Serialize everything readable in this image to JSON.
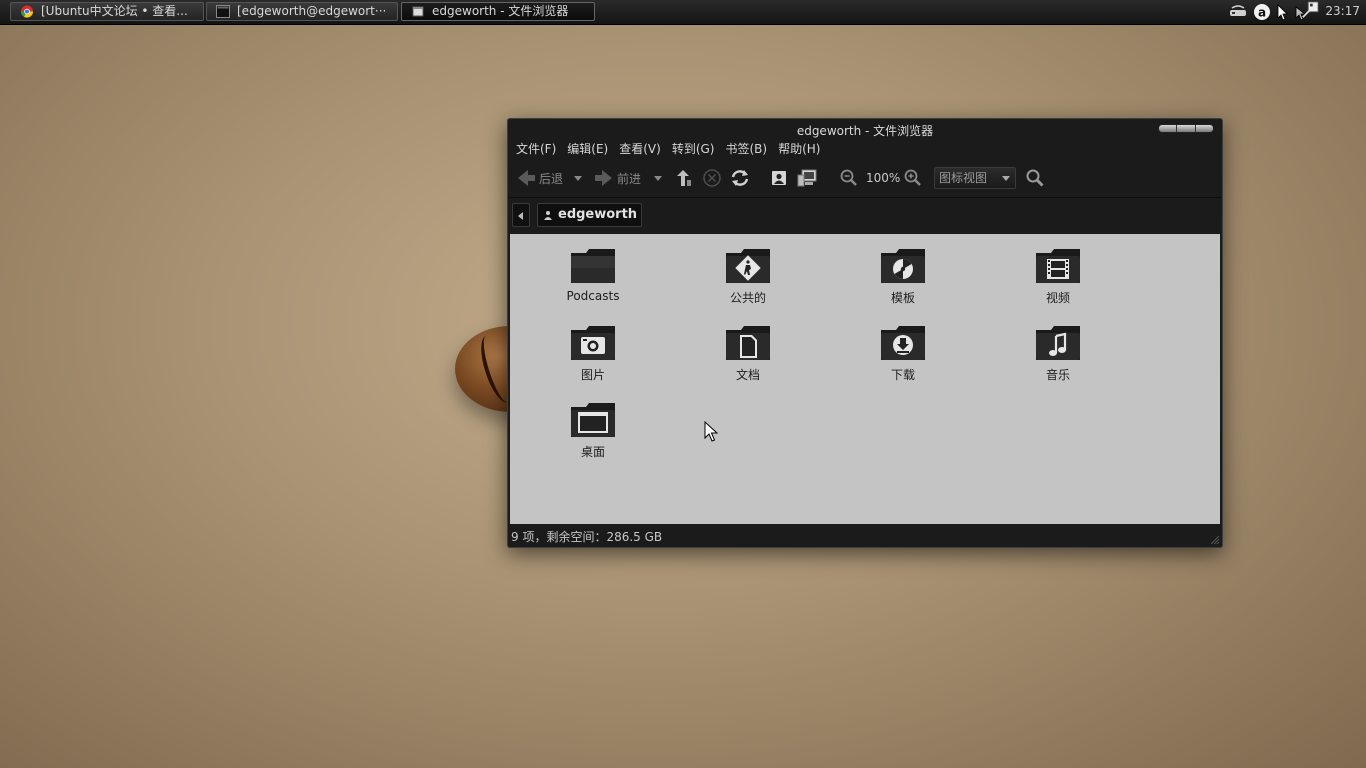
{
  "taskbar": {
    "tasks": [
      {
        "label": "[Ubuntu中文论坛 • 查看...",
        "icon": "chrome-icon"
      },
      {
        "label": "[edgeworth@edgewort···",
        "icon": "terminal-icon"
      },
      {
        "label": "edgeworth - 文件浏览器",
        "icon": "file-manager-icon"
      }
    ],
    "tray_icons": [
      "network-icon",
      "a-badge-icon",
      "pointer-icon",
      "pointer-icon",
      "screenshot-icon"
    ],
    "clock": "23:17"
  },
  "window": {
    "title": "edgeworth - 文件浏览器",
    "menu": [
      "文件(F)",
      "编辑(E)",
      "查看(V)",
      "转到(G)",
      "书签(B)",
      "帮助(H)"
    ],
    "toolbar": {
      "back_label": "后退",
      "forward_label": "前进",
      "zoom_level": "100%",
      "view_mode": "图标视图"
    },
    "location": {
      "crumb": "edgeworth"
    },
    "files": [
      {
        "name": "Podcasts",
        "icon": "folder-icon"
      },
      {
        "name": "公共的",
        "icon": "folder-public-icon"
      },
      {
        "name": "模板",
        "icon": "folder-templates-icon"
      },
      {
        "name": "视频",
        "icon": "folder-videos-icon"
      },
      {
        "name": "图片",
        "icon": "folder-pictures-icon"
      },
      {
        "name": "文档",
        "icon": "folder-documents-icon"
      },
      {
        "name": "下载",
        "icon": "folder-downloads-icon"
      },
      {
        "name": "音乐",
        "icon": "folder-music-icon"
      },
      {
        "name": "桌面",
        "icon": "folder-desktop-icon"
      }
    ],
    "status": "9 项，剩余空间：286.5 GB"
  },
  "colors": {
    "panel_bg": "#1a1a1a",
    "window_bg": "#1b1b1b",
    "content_bg": "#c4c4c4",
    "desktop_bg": "#a99273"
  }
}
